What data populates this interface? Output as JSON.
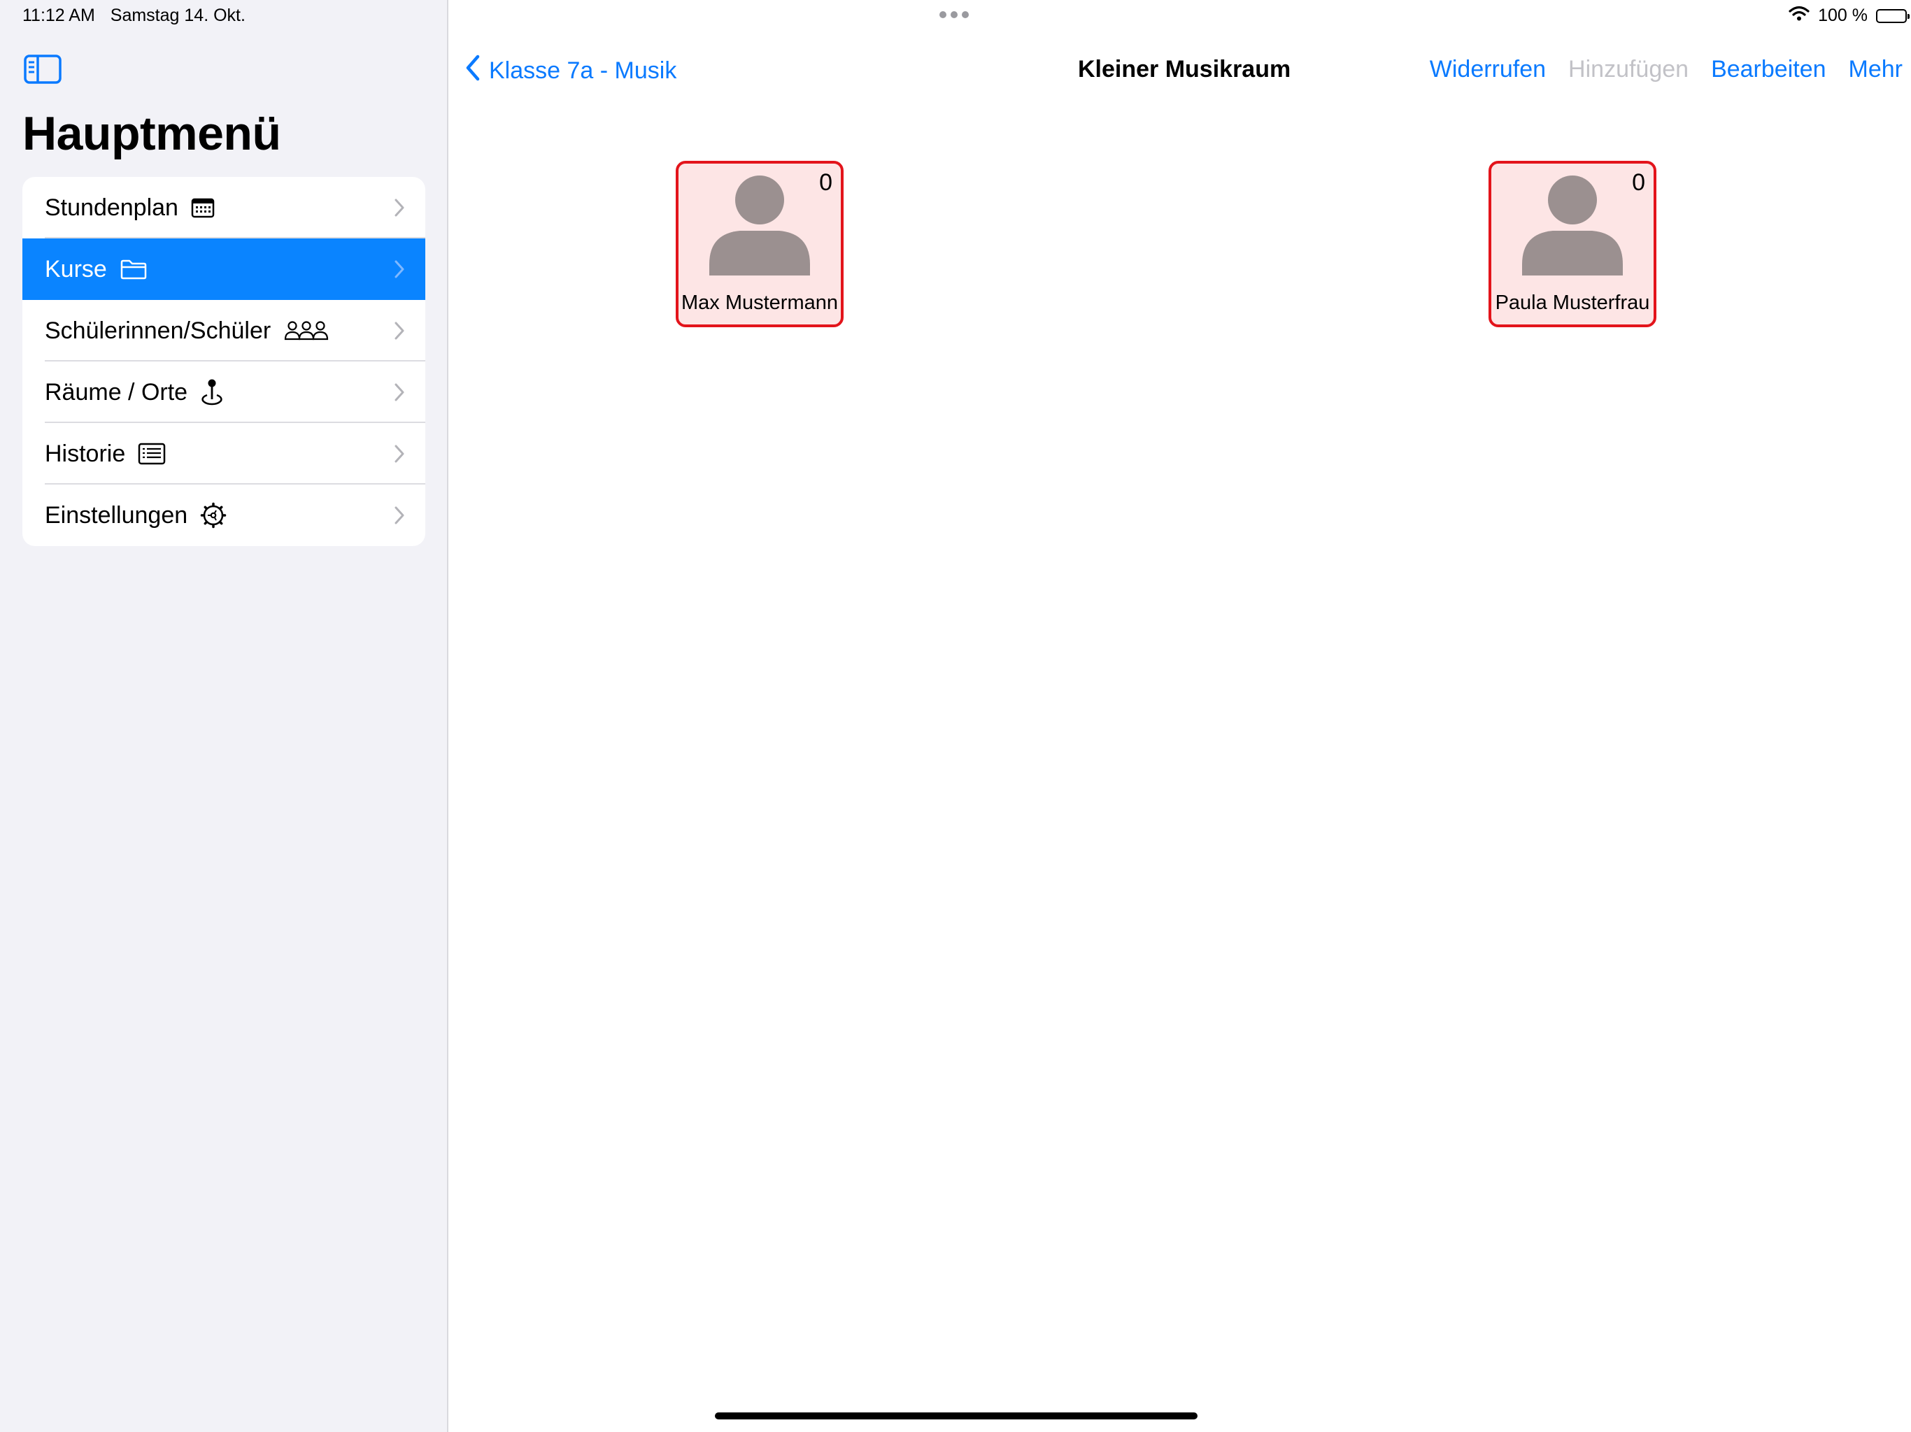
{
  "status": {
    "time": "11:12 AM",
    "date": "Samstag 14. Okt.",
    "battery": "100 %"
  },
  "sidebar": {
    "title": "Hauptmenü",
    "items": [
      {
        "label": "Stundenplan",
        "icon": "calendar-icon"
      },
      {
        "label": "Kurse",
        "icon": "folder-icon",
        "selected": true
      },
      {
        "label": "Schülerinnen/Schüler",
        "icon": "people-icon"
      },
      {
        "label": "Räume / Orte",
        "icon": "location-pin-icon"
      },
      {
        "label": "Historie",
        "icon": "list-icon"
      },
      {
        "label": "Einstellungen",
        "icon": "gear-icon"
      }
    ]
  },
  "nav": {
    "back_label": "Klasse 7a - Musik",
    "title": "Kleiner Musikraum",
    "actions": {
      "undo": "Widerrufen",
      "add": "Hinzufügen",
      "edit": "Bearbeiten",
      "more": "Mehr"
    }
  },
  "students": [
    {
      "name": "Max Mustermann",
      "count": "0"
    },
    {
      "name": "Paula Musterfrau",
      "count": "0"
    }
  ],
  "colors": {
    "accent": "#0a7aff",
    "selected_row": "#0a84ff",
    "tile_border": "#e3141b",
    "tile_background": "#fde5e5",
    "avatar": "#9b9090"
  }
}
